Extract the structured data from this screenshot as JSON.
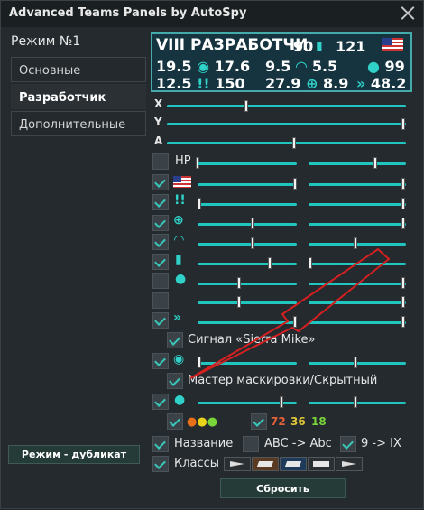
{
  "window": {
    "title": "Advanced Teams Panels by AutoSpy"
  },
  "left": {
    "mode_title": "Режим №1",
    "tabs": [
      "Основные",
      "Разработчик",
      "Дополнительные"
    ],
    "dup_button": "Режим - дубликат"
  },
  "preview": {
    "name": "VIII РАЗРАБОТЧИ",
    "r1": [
      "19.5",
      "17.6",
      "9.5",
      "5.5",
      "99"
    ],
    "r2": [
      "12.5",
      "150",
      "27.9",
      "8.9",
      "48.2"
    ],
    "val90": "90",
    "val121": "121"
  },
  "axes": [
    "X",
    "Y",
    "A"
  ],
  "hp": "HP",
  "signal": "Сигнал «Sierra Mike»",
  "camo": "Мастер маскировки/Скрытный",
  "counts": {
    "red": "72",
    "yellow": "36",
    "green": "18"
  },
  "name_label": "Название",
  "abc": "ABC -> Abc",
  "roman": "9 -> IX",
  "classes_label": "Классы",
  "reset": "Сбросить",
  "colors": {
    "accent": "#2fd1c8",
    "panel": "#163440"
  }
}
